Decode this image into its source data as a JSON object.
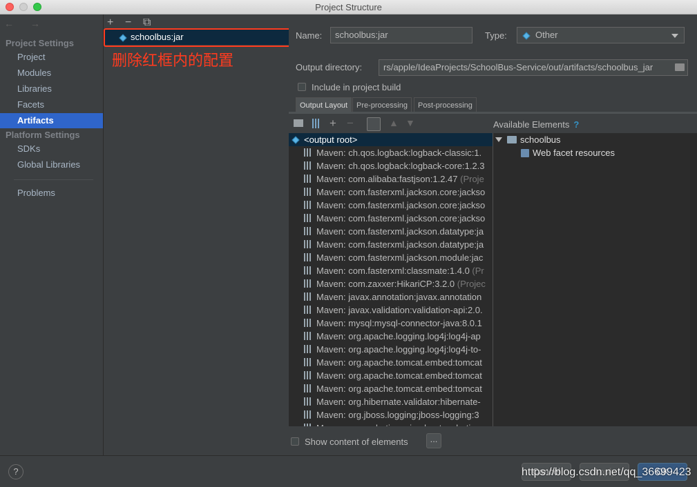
{
  "window": {
    "title": "Project Structure"
  },
  "nav": {
    "back_forward": "← →",
    "project_settings_header": "Project Settings",
    "project_items": [
      "Project",
      "Modules",
      "Libraries",
      "Facets",
      "Artifacts"
    ],
    "platform_settings_header": "Platform Settings",
    "platform_items": [
      "SDKs",
      "Global Libraries"
    ],
    "problems": "Problems"
  },
  "artifacts_panel": {
    "add": "+",
    "remove": "−",
    "copy": "⧉",
    "selected_artifact": "schoolbus:jar",
    "annotation": "删除红框内的配置"
  },
  "details": {
    "name_label": "Name:",
    "name_value": "schoolbus:jar",
    "type_label": "Type:",
    "type_value": "Other",
    "output_label": "Output directory:",
    "output_value": "rs/apple/IdeaProjects/SchoolBus-Service/out/artifacts/schoolbus_jar",
    "include_build": "Include in project build",
    "tabs": [
      "Output Layout",
      "Pre-processing",
      "Post-processing"
    ],
    "available_elements": "Available Elements",
    "help_q": "?",
    "output_root": "<output root>",
    "libraries": [
      {
        "name": "Maven: ch.qos.logback:logback-classic:1.",
        "suffix": ""
      },
      {
        "name": "Maven: ch.qos.logback:logback-core:1.2.3",
        "suffix": ""
      },
      {
        "name": "Maven: com.alibaba:fastjson:1.2.47",
        "suffix": " (Proje"
      },
      {
        "name": "Maven: com.fasterxml.jackson.core:jackso",
        "suffix": ""
      },
      {
        "name": "Maven: com.fasterxml.jackson.core:jackso",
        "suffix": ""
      },
      {
        "name": "Maven: com.fasterxml.jackson.core:jackso",
        "suffix": ""
      },
      {
        "name": "Maven: com.fasterxml.jackson.datatype:ja",
        "suffix": ""
      },
      {
        "name": "Maven: com.fasterxml.jackson.datatype:ja",
        "suffix": ""
      },
      {
        "name": "Maven: com.fasterxml.jackson.module:jac",
        "suffix": ""
      },
      {
        "name": "Maven: com.fasterxml:classmate:1.4.0",
        "suffix": " (Pr"
      },
      {
        "name": "Maven: com.zaxxer:HikariCP:3.2.0",
        "suffix": " (Projec"
      },
      {
        "name": "Maven: javax.annotation:javax.annotation",
        "suffix": ""
      },
      {
        "name": "Maven: javax.validation:validation-api:2.0.",
        "suffix": ""
      },
      {
        "name": "Maven: mysql:mysql-connector-java:8.0.1",
        "suffix": ""
      },
      {
        "name": "Maven: org.apache.logging.log4j:log4j-ap",
        "suffix": ""
      },
      {
        "name": "Maven: org.apache.logging.log4j:log4j-to-",
        "suffix": ""
      },
      {
        "name": "Maven: org.apache.tomcat.embed:tomcat",
        "suffix": ""
      },
      {
        "name": "Maven: org.apache.tomcat.embed:tomcat",
        "suffix": ""
      },
      {
        "name": "Maven: org.apache.tomcat.embed:tomcat",
        "suffix": ""
      },
      {
        "name": "Maven: org.hibernate.validator:hibernate-",
        "suffix": ""
      },
      {
        "name": "Maven: org.jboss.logging:jboss-logging:3",
        "suffix": ""
      },
      {
        "name": "Maven: org.mybatis.spring.boot:mybatis",
        "suffix": ""
      }
    ],
    "tree_root": "schoolbus",
    "tree_child": "Web facet resources",
    "show_content": "Show content of elements",
    "ellipsis": "..."
  },
  "footer": {
    "help": "?",
    "cancel": "Cancel",
    "apply": "Apply",
    "ok": "OK",
    "watermark": "https://blog.csdn.net/qq_36699423"
  }
}
